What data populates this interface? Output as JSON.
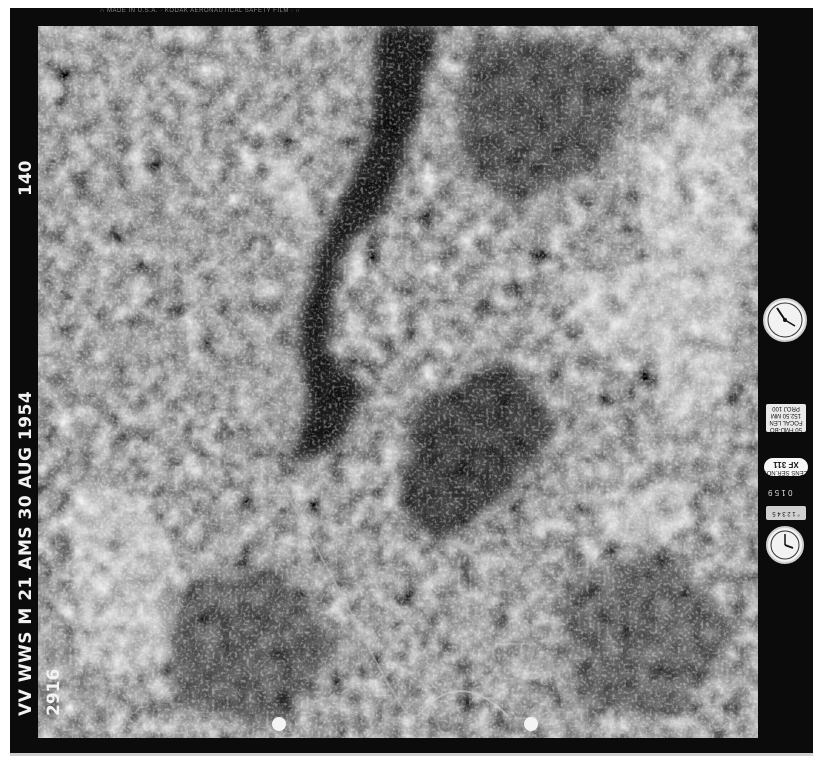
{
  "photo": {
    "frame_number": "140",
    "mission_label": "VV WWS M 21 AMS 30 AUG 1954",
    "frame_code": "2916",
    "top_strip_text": "∩ MADE IN U.S.A. · KODAK AERONAUTICAL SAFETY FILM · ∩",
    "subject": "aerial-photograph-mountain-terrain"
  },
  "side_panel": {
    "data_block_lines": [
      "50 FMD-BO",
      "FOCAL LEN",
      "152.50 MM",
      "PROJ 100"
    ],
    "lens_label": "LENS SER.NO.",
    "lens_code": "XF 311",
    "counter_text": "0 1 5 9",
    "altitude_block": "° 1 2 3 4 5",
    "icons": [
      "altimeter-gauge-icon",
      "clock-gauge-icon"
    ]
  },
  "colors": {
    "frame": "#0b0b0b",
    "background": "#ffffff",
    "annotation_text": "#f2f2f2"
  }
}
